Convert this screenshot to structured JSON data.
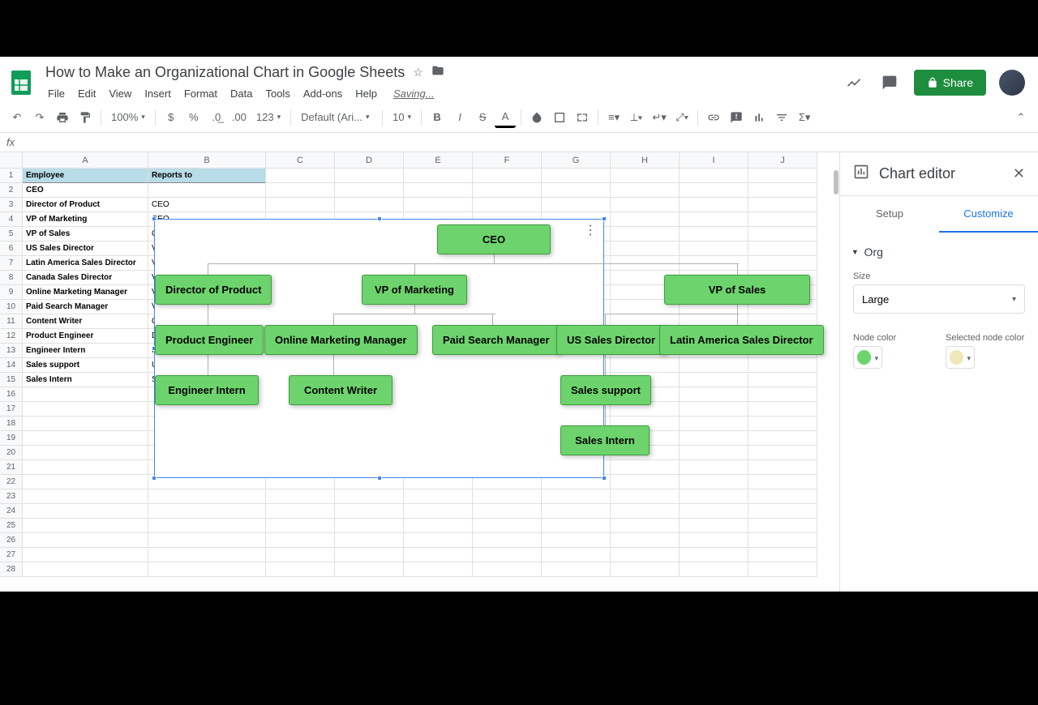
{
  "doc": {
    "title": "How to Make an Organizational Chart in Google Sheets",
    "saving": "Saving..."
  },
  "menus": {
    "file": "File",
    "edit": "Edit",
    "view": "View",
    "insert": "Insert",
    "format": "Format",
    "data": "Data",
    "tools": "Tools",
    "addons": "Add-ons",
    "help": "Help"
  },
  "toolbar": {
    "zoom": "100%",
    "font": "Default (Ari...",
    "font_size": "10",
    "number_format": "123"
  },
  "share": {
    "label": "Share"
  },
  "columns": [
    "A",
    "B",
    "C",
    "D",
    "E",
    "F",
    "G",
    "H",
    "I",
    "J"
  ],
  "headers": {
    "employee": "Employee",
    "reports_to": "Reports to"
  },
  "table": [
    {
      "a": "CEO",
      "b": ""
    },
    {
      "a": "Director of Product",
      "b": "CEO"
    },
    {
      "a": "VP of Marketing",
      "b": "CEO"
    },
    {
      "a": "VP of Sales",
      "b": "CEO"
    },
    {
      "a": "US Sales Director",
      "b": "VP of Sales"
    },
    {
      "a": "Latin America Sales Director",
      "b": "VP of Sales"
    },
    {
      "a": "Canada Sales Director",
      "b": "VP of Sales"
    },
    {
      "a": "Online Marketing Manager",
      "b": "VP of Marketing"
    },
    {
      "a": "Paid Search Manager",
      "b": "VP of Marketing"
    },
    {
      "a": "Content Writer",
      "b": "Online Marketing Manager"
    },
    {
      "a": "Product Engineer",
      "b": "Director of Product"
    },
    {
      "a": "Engineer Intern",
      "b": "Product Engineer"
    },
    {
      "a": "Sales support",
      "b": "US Sales Director"
    },
    {
      "a": "Sales Intern",
      "b": "Sales support"
    }
  ],
  "chart_data": {
    "type": "org",
    "nodes": [
      {
        "id": "CEO",
        "parent": null,
        "label": "CEO"
      },
      {
        "id": "Director of Product",
        "parent": "CEO",
        "label": "Director of Product"
      },
      {
        "id": "VP of Marketing",
        "parent": "CEO",
        "label": "VP of Marketing"
      },
      {
        "id": "VP of Sales",
        "parent": "CEO",
        "label": "VP of Sales"
      },
      {
        "id": "Product Engineer",
        "parent": "Director of Product",
        "label": "Product Engineer"
      },
      {
        "id": "Online Marketing Manager",
        "parent": "VP of Marketing",
        "label": "Online Marketing Manager"
      },
      {
        "id": "Paid Search Manager",
        "parent": "VP of Marketing",
        "label": "Paid Search Manager"
      },
      {
        "id": "US Sales Director",
        "parent": "VP of Sales",
        "label": "US Sales Director"
      },
      {
        "id": "Latin America Sales Director",
        "parent": "VP of Sales",
        "label": "Latin America Sales Director"
      },
      {
        "id": "Engineer Intern",
        "parent": "Product Engineer",
        "label": "Engineer Intern"
      },
      {
        "id": "Content Writer",
        "parent": "Online Marketing Manager",
        "label": "Content Writer"
      },
      {
        "id": "Sales support",
        "parent": "US Sales Director",
        "label": "Sales support"
      },
      {
        "id": "Sales Intern",
        "parent": "Sales support",
        "label": "Sales Intern"
      }
    ],
    "node_color": "#6dd46d",
    "selected_node_color": "#f0e6b8"
  },
  "editor": {
    "title": "Chart editor",
    "tab_setup": "Setup",
    "tab_customize": "Customize",
    "section_org": "Org",
    "size_label": "Size",
    "size_value": "Large",
    "node_color_label": "Node color",
    "selected_node_color_label": "Selected node color"
  }
}
